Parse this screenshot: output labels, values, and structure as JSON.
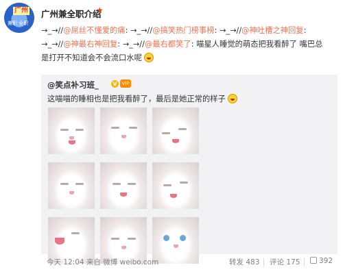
{
  "post": {
    "author": {
      "name": "广州兼全职介绍",
      "avatar_text_top": "广州",
      "avatar_text_bottom": "兼职 全职"
    },
    "icons": {
      "badge": "star-icon",
      "emoji": "laugh-emoji-icon"
    },
    "body_line1": {
      "a1": "→_→//",
      "l1": "@屌丝不懂爱的痛",
      "a2": ": →_→//",
      "l2": "@搞笑热门榜事榜",
      "a3": ": →_→//",
      "l3": "@神吐槽之神回复",
      "a4": ":"
    },
    "body_line2": {
      "a1": "→_→//",
      "l1": "@神最右神回复",
      "a2": ": →_→//",
      "l2": "@最右都笑了",
      "text": ": 喵星人睡觉的萌态把我看醉了 嘴巴总"
    },
    "body_line3": {
      "text": "是打开不知道会不会流口水呢"
    },
    "repost": {
      "author": "@笑点补习班_",
      "text": "这喵喵的睡相也是把我看醉了，最后是她正常的样子"
    },
    "footer": {
      "time": "今天 12:04 来自 微博 weibo.com",
      "repost": "转发 483",
      "comment": "评论 175",
      "like": "392"
    }
  }
}
